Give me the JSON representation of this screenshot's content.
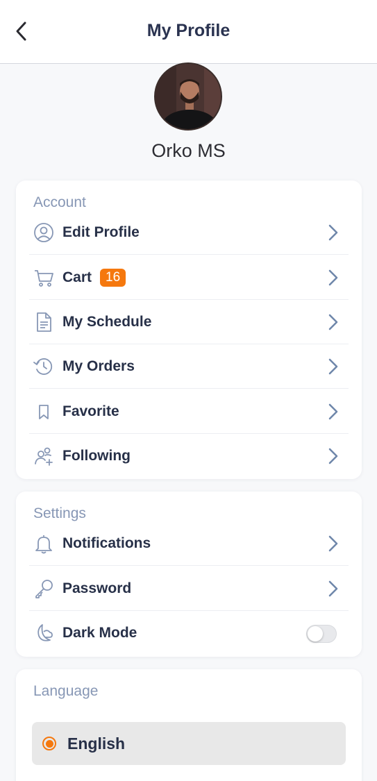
{
  "header": {
    "title": "My Profile",
    "back_icon": "chevron-left-icon"
  },
  "profile": {
    "name": "Orko MS"
  },
  "account": {
    "title": "Account",
    "items": [
      {
        "label": "Edit Profile",
        "icon": "user-circle-icon"
      },
      {
        "label": "Cart",
        "icon": "cart-icon",
        "badge": "16"
      },
      {
        "label": "My Schedule",
        "icon": "document-icon"
      },
      {
        "label": "My Orders",
        "icon": "history-icon"
      },
      {
        "label": "Favorite",
        "icon": "bookmark-icon"
      },
      {
        "label": "Following",
        "icon": "users-add-icon"
      }
    ]
  },
  "settings": {
    "title": "Settings",
    "items": [
      {
        "label": "Notifications",
        "icon": "bell-icon"
      },
      {
        "label": "Password",
        "icon": "key-icon"
      },
      {
        "label": "Dark Mode",
        "icon": "moon-icon",
        "toggle_on": false
      }
    ]
  },
  "language": {
    "title": "Language",
    "selected": "English"
  },
  "colors": {
    "accent": "#f5780e",
    "icon": "#8797b5",
    "text": "#273048"
  }
}
